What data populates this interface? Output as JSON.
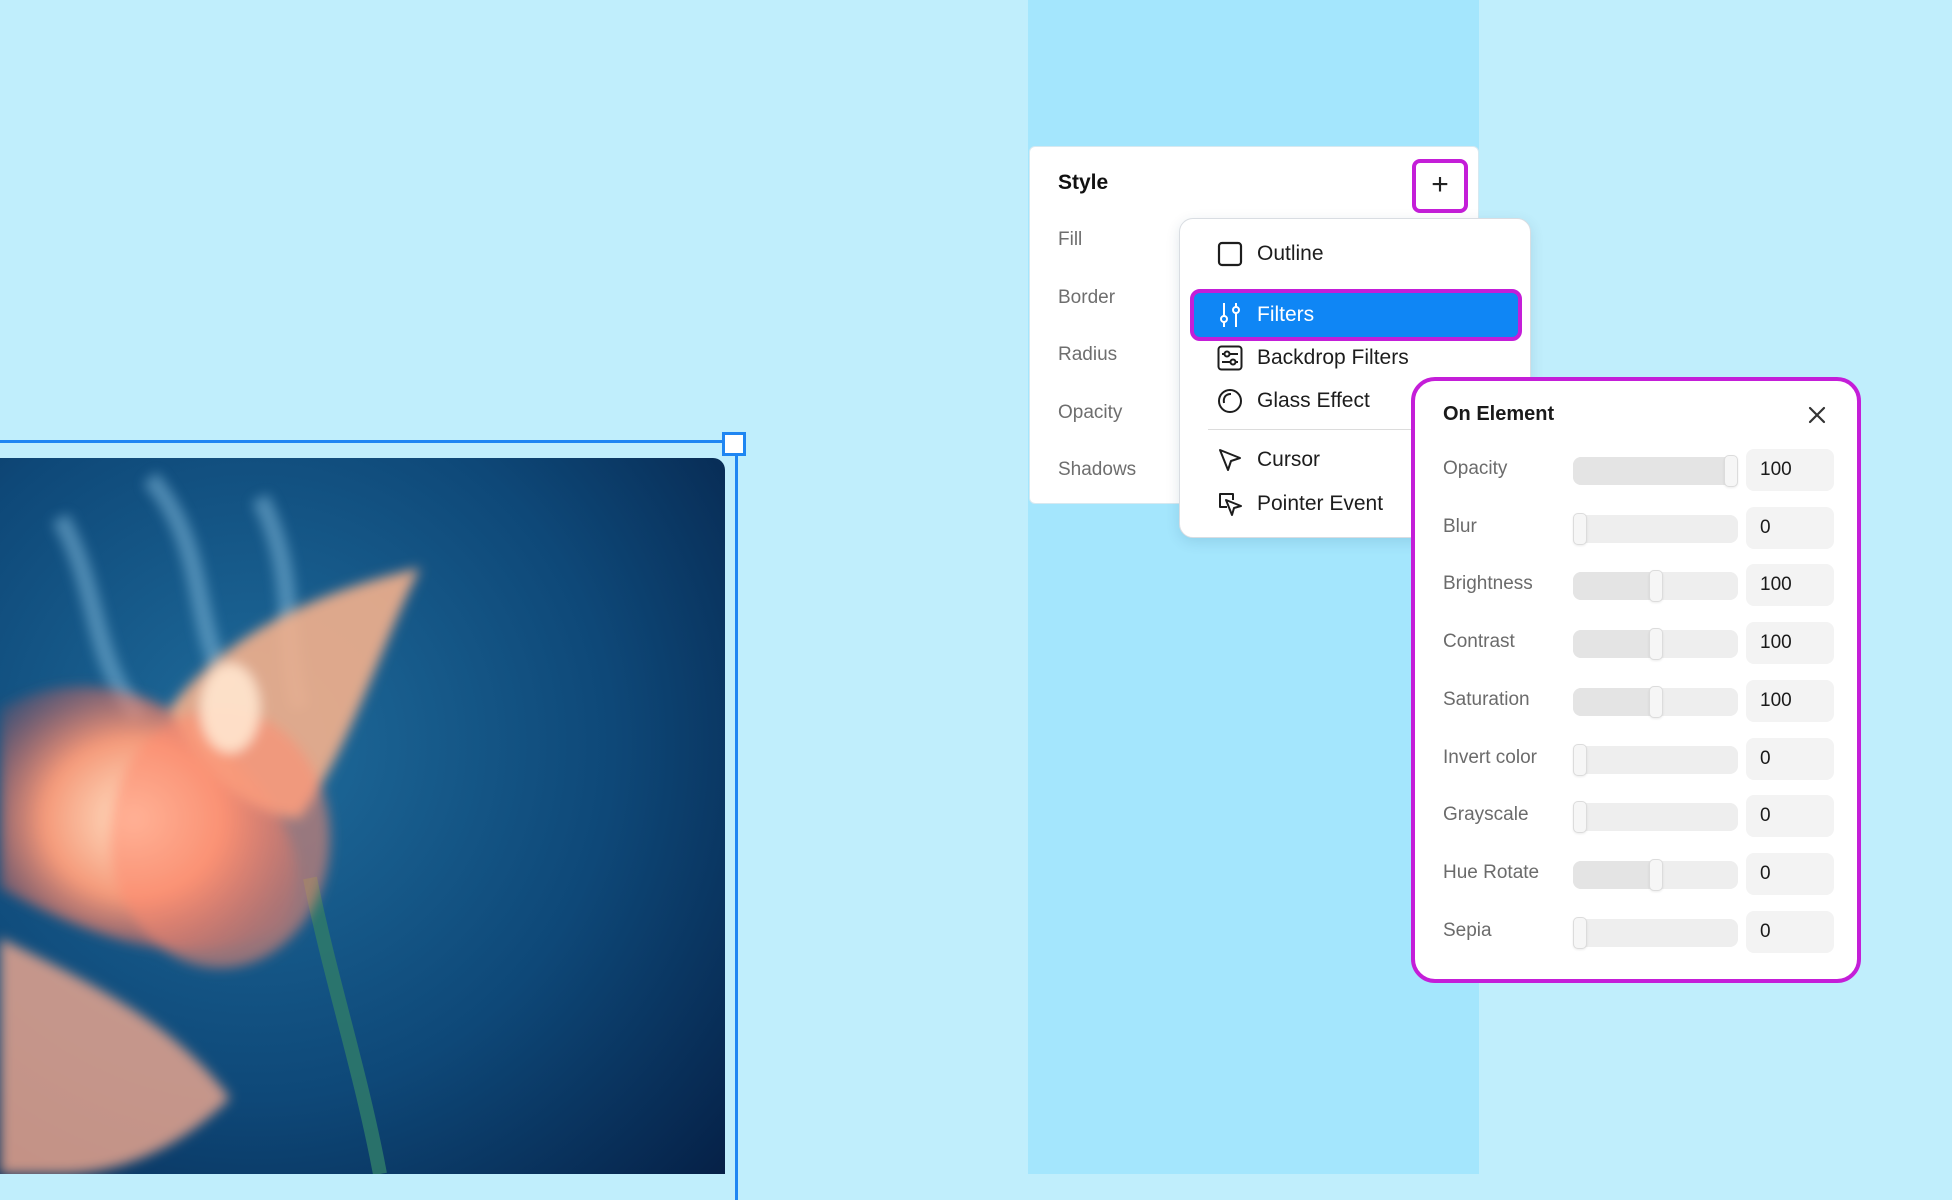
{
  "style_panel": {
    "title": "Style",
    "add_label": "+",
    "rows": [
      "Fill",
      "Border",
      "Radius",
      "Opacity",
      "Shadows"
    ]
  },
  "menu": {
    "items": [
      {
        "label": "Outline",
        "icon": "outline-square-icon",
        "active": false
      },
      {
        "label": "Filters",
        "icon": "sliders-icon",
        "active": true
      },
      {
        "label": "Backdrop Filters",
        "icon": "backdrop-filters-icon",
        "active": false
      },
      {
        "label": "Glass Effect",
        "icon": "glass-circle-icon",
        "active": false
      },
      {
        "label": "Cursor",
        "icon": "cursor-arrow-icon",
        "active": false
      },
      {
        "label": "Pointer Event",
        "icon": "pointer-event-icon",
        "active": false
      }
    ]
  },
  "filter_panel": {
    "title": "On Element",
    "rows": [
      {
        "label": "Opacity",
        "value": "100",
        "level": 1.0
      },
      {
        "label": "Blur",
        "value": "0",
        "level": 0.0
      },
      {
        "label": "Brightness",
        "value": "100",
        "level": 0.5
      },
      {
        "label": "Contrast",
        "value": "100",
        "level": 0.5
      },
      {
        "label": "Saturation",
        "value": "100",
        "level": 0.5
      },
      {
        "label": "Invert color",
        "value": "0",
        "level": 0.0
      },
      {
        "label": "Grayscale",
        "value": "0",
        "level": 0.0
      },
      {
        "label": "Hue Rotate",
        "value": "0",
        "level": 0.5
      },
      {
        "label": "Sepia",
        "value": "0",
        "level": 0.0
      }
    ]
  },
  "colors": {
    "canvas_bg": "#c0eefc",
    "highlight": "#c41ed8",
    "accent": "#0f86f5",
    "selection": "#1f86f2"
  }
}
